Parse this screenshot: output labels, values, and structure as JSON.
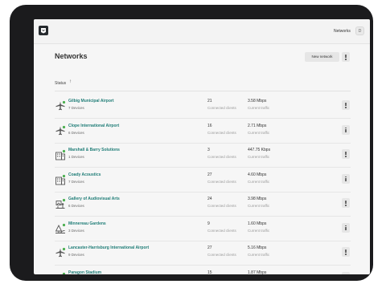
{
  "topbar": {
    "nav_link": "Networks",
    "avatar_initial": "D"
  },
  "page": {
    "title": "Networks",
    "new_button_label": "New network"
  },
  "table": {
    "status_header": "Status",
    "sort_arrow": "↑",
    "clients_label": "Connected clients",
    "traffic_label": "Current traffic",
    "rows": [
      {
        "name": "Gilbig Municipal Airport",
        "devices": "7 Devices",
        "clients": "21",
        "traffic": "3.58 Mbps",
        "icon": "airplane-icon"
      },
      {
        "name": "Clope International Airport",
        "devices": "6 Devices",
        "clients": "16",
        "traffic": "2.71 Mbps",
        "icon": "airplane-icon"
      },
      {
        "name": "Marshall & Barry Solutions",
        "devices": "1 Devices",
        "clients": "3",
        "traffic": "447.75 Kbps",
        "icon": "building-icon"
      },
      {
        "name": "Coady Acoustics",
        "devices": "7 Devices",
        "clients": "27",
        "traffic": "4.60 Mbps",
        "icon": "building-icon"
      },
      {
        "name": "Gallery of Audiovisual Arts",
        "devices": "6 Devices",
        "clients": "24",
        "traffic": "3.98 Mbps",
        "icon": "gallery-icon"
      },
      {
        "name": "Minnereau Gardens",
        "devices": "3 Devices",
        "clients": "9",
        "traffic": "1.60 Mbps",
        "icon": "garden-icon"
      },
      {
        "name": "Lancaster-Harrisburg International Airport",
        "devices": "9 Devices",
        "clients": "27",
        "traffic": "5.16 Mbps",
        "icon": "airplane-icon"
      },
      {
        "name": "Paragon Stadium",
        "devices": "",
        "clients": "15",
        "traffic": "1.87 Mbps",
        "icon": "stadium-icon"
      }
    ]
  },
  "colors": {
    "link": "#1f7d77",
    "status_ok": "#4caf50",
    "device_frame": "#1b1b1d"
  }
}
